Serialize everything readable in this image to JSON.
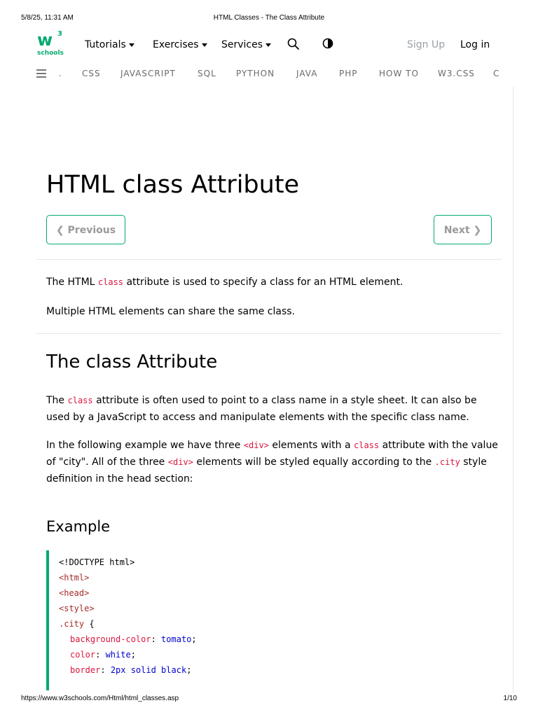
{
  "print": {
    "datetime": "5/8/25, 11:31 AM",
    "doc_title": "HTML Classes - The Class Attribute",
    "url": "https://www.w3schools.com/Html/html_classes.asp",
    "page": "1/10"
  },
  "logo": {
    "mark": "w",
    "sup": "3",
    "sub": "schools",
    "color": "#04aa6d"
  },
  "topnav": {
    "tutorials": "Tutorials",
    "exercises": "Exercises",
    "services": "Services",
    "sign_up": "Sign Up",
    "log_in": "Log in"
  },
  "subnav": {
    "items": [
      ".",
      "CSS",
      "JAVASCRIPT",
      "SQL",
      "PYTHON",
      "JAVA",
      "PHP",
      "HOW TO",
      "W3.CSS",
      "C"
    ]
  },
  "content": {
    "title": "HTML class Attribute",
    "prev": "❮ Previous",
    "next": "Next ❯",
    "intro1_a": "The HTML ",
    "intro1_code": "class",
    "intro1_b": " attribute is used to specify a class for an HTML element.",
    "intro2": "Multiple HTML elements can share the same class.",
    "h2": "The class Attribute",
    "p1_a": "The ",
    "p1_code": "class",
    "p1_b": " attribute is often used to point to a class name in a style sheet. It can also be used by a JavaScript to access and manipulate elements with the specific class name.",
    "p2_a": "In the following example we have three ",
    "p2_code1": "<div>",
    "p2_b": " elements with a ",
    "p2_code2": "class",
    "p2_c": " attribute with the value of \"city\". All of the three ",
    "p2_code3": "<div>",
    "p2_d": " elements will be styled equally according to the ",
    "p2_code4": ".city",
    "p2_e": " style definition in the head section:",
    "example": "Example"
  },
  "code": {
    "l1": "<!DOCTYPE html>",
    "l2": "<html>",
    "l3": "<head>",
    "l4": "<style>",
    "l5_sel": ".city",
    "l5_brace": " {",
    "l6_prop": "background-color",
    "l6_val": "tomato",
    "l7_prop": "color",
    "l7_val": "white",
    "l8_prop": "border",
    "l8_val": "2px solid black",
    "colon": ": ",
    "semi": ";"
  },
  "colors": {
    "accent": "#04aa6d",
    "code_keyword": "#dc143c",
    "code_value": "#0000cd",
    "code_tag": "#a52a2a"
  }
}
